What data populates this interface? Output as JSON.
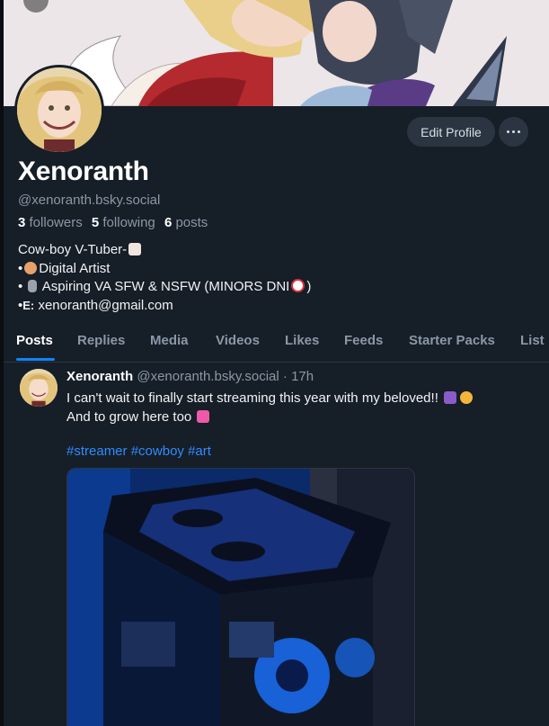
{
  "profile": {
    "display_name": "Xenoranth",
    "handle": "@xenoranth.bsky.social",
    "followers_count": "3",
    "followers_label": "followers",
    "following_count": "5",
    "following_label": "following",
    "posts_count": "6",
    "posts_label": "posts",
    "edit_button": "Edit Profile",
    "bio": {
      "line1": "Cow-boy V-Tuber-",
      "line2": "Digital Artist",
      "line3": "Aspiring VA SFW & NSFW (MINORS DNI",
      "line3_end": ")",
      "line4_prefix": "E:",
      "line4": "xenoranth@gmail.com"
    }
  },
  "tabs": [
    {
      "label": "Posts"
    },
    {
      "label": "Replies"
    },
    {
      "label": "Media"
    },
    {
      "label": "Videos"
    },
    {
      "label": "Likes"
    },
    {
      "label": "Feeds"
    },
    {
      "label": "Starter Packs"
    },
    {
      "label": "List"
    }
  ],
  "post": {
    "author": "Xenoranth",
    "handle": "@xenoranth.bsky.social",
    "time": "17h",
    "line1": "I can't wait to finally start streaming this year with my beloved!!",
    "line2": "And to grow here too",
    "tags": [
      "#streamer",
      "#cowboy",
      "#art"
    ]
  },
  "colors": {
    "background": "#161e27",
    "accent": "#1083fe",
    "muted": "#8a98a6",
    "link": "#2f8cff"
  },
  "icons": {
    "more": "more-horizontal-icon",
    "cow": "cow-emoji",
    "palette": "palette-emoji",
    "mic": "microphone-emoji",
    "no_under_18": "no-under-18-emoji",
    "pray": "folded-hands-emoji",
    "pleading": "pleading-face-emoji",
    "heart": "pink-heart-emoji"
  }
}
